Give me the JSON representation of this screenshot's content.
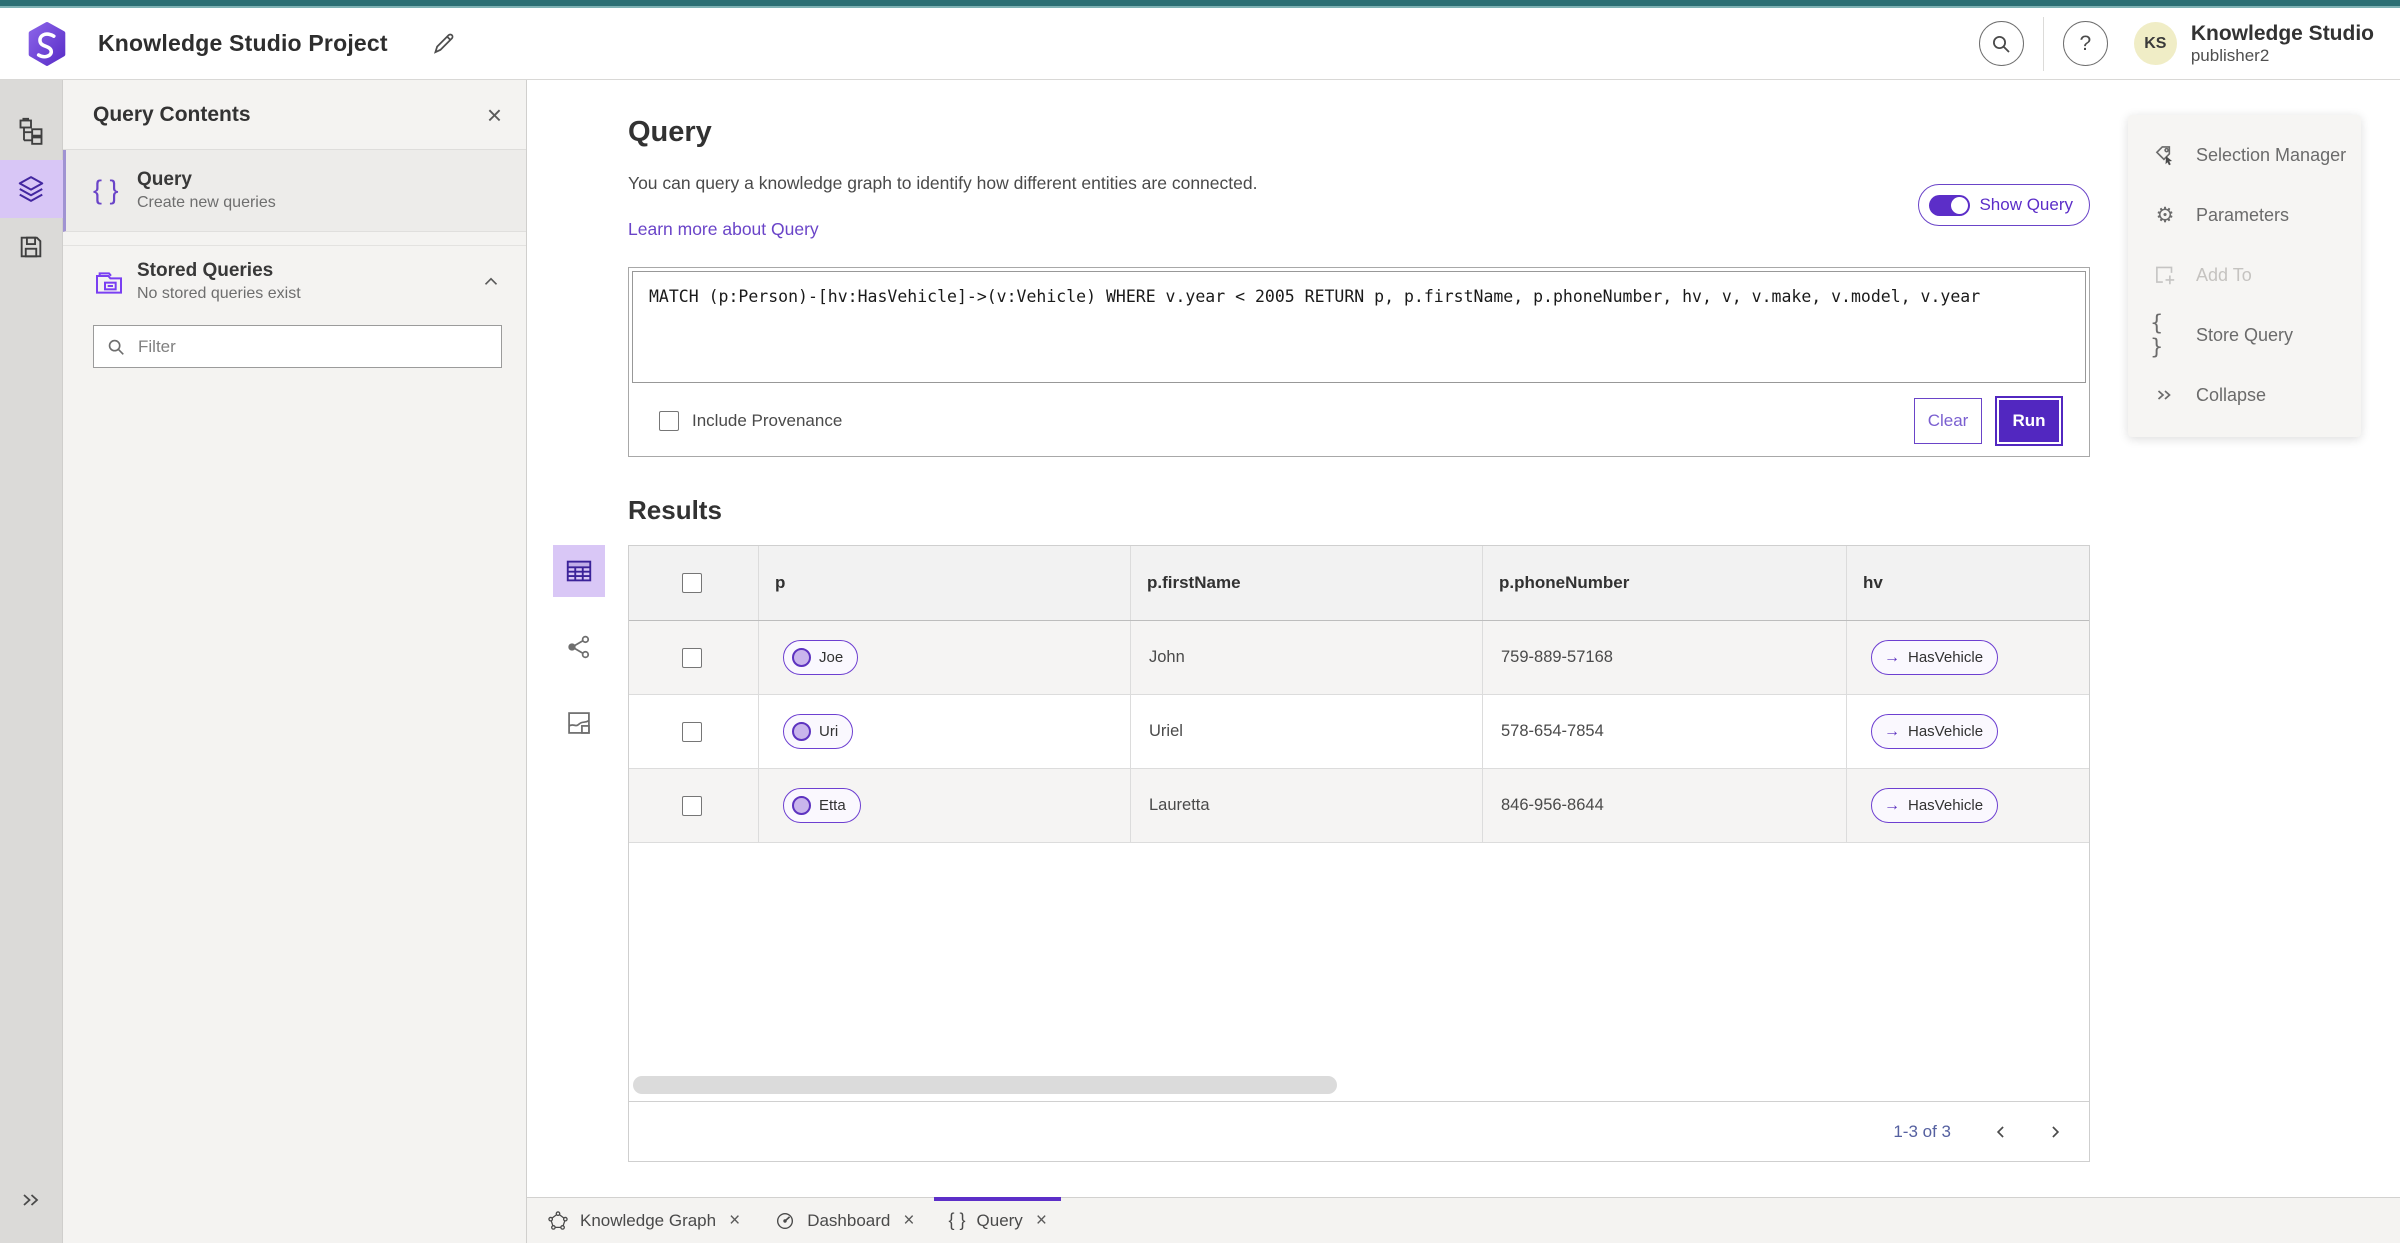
{
  "header": {
    "title": "Knowledge Studio Project",
    "app_name": "Knowledge Studio",
    "user_initials": "KS",
    "username": "publisher2"
  },
  "left_panel": {
    "title": "Query Contents",
    "query_item": {
      "title": "Query",
      "subtitle": "Create new queries"
    },
    "stored_queries": {
      "title": "Stored Queries",
      "subtitle": "No stored queries exist"
    },
    "filter_placeholder": "Filter"
  },
  "query_section": {
    "title": "Query",
    "description": "You can query a knowledge graph to identify how different entities are connected.",
    "learn_more": "Learn more about Query",
    "show_query_label": "Show Query",
    "query_text": "MATCH (p:Person)-[hv:HasVehicle]->(v:Vehicle) WHERE v.year < 2005 RETURN p, p.firstName, p.phoneNumber, hv, v, v.make, v.model, v.year",
    "include_provenance_label": "Include Provenance",
    "clear_label": "Clear",
    "run_label": "Run"
  },
  "results": {
    "title": "Results",
    "columns": [
      "p",
      "p.firstName",
      "p.phoneNumber",
      "hv"
    ],
    "rows": [
      {
        "p": "Joe",
        "firstName": "John",
        "phoneNumber": "759-889-57168",
        "hv": "HasVehicle"
      },
      {
        "p": "Uri",
        "firstName": "Uriel",
        "phoneNumber": "578-654-7854",
        "hv": "HasVehicle"
      },
      {
        "p": "Etta",
        "firstName": "Lauretta",
        "phoneNumber": "846-956-8644",
        "hv": "HasVehicle"
      }
    ],
    "pagination": "1-3 of 3"
  },
  "right_panel": {
    "selection_manager": "Selection Manager",
    "parameters": "Parameters",
    "add_to": "Add To",
    "store_query": "Store Query",
    "collapse": "Collapse"
  },
  "tabs": [
    {
      "label": "Knowledge Graph"
    },
    {
      "label": "Dashboard"
    },
    {
      "label": "Query"
    }
  ],
  "icons": {
    "close": "×",
    "braces": "{ }",
    "question": "?",
    "gear": "⚙",
    "arrow_right": "→",
    "double_chevron": "»"
  },
  "colors": {
    "accent_purple": "#5c2ec8",
    "teal_strip": "#2c6f74",
    "panel_bg": "#f4f3f1",
    "selected_rail_bg": "#d8c6f6",
    "avatar_bg": "#f0edc6"
  }
}
